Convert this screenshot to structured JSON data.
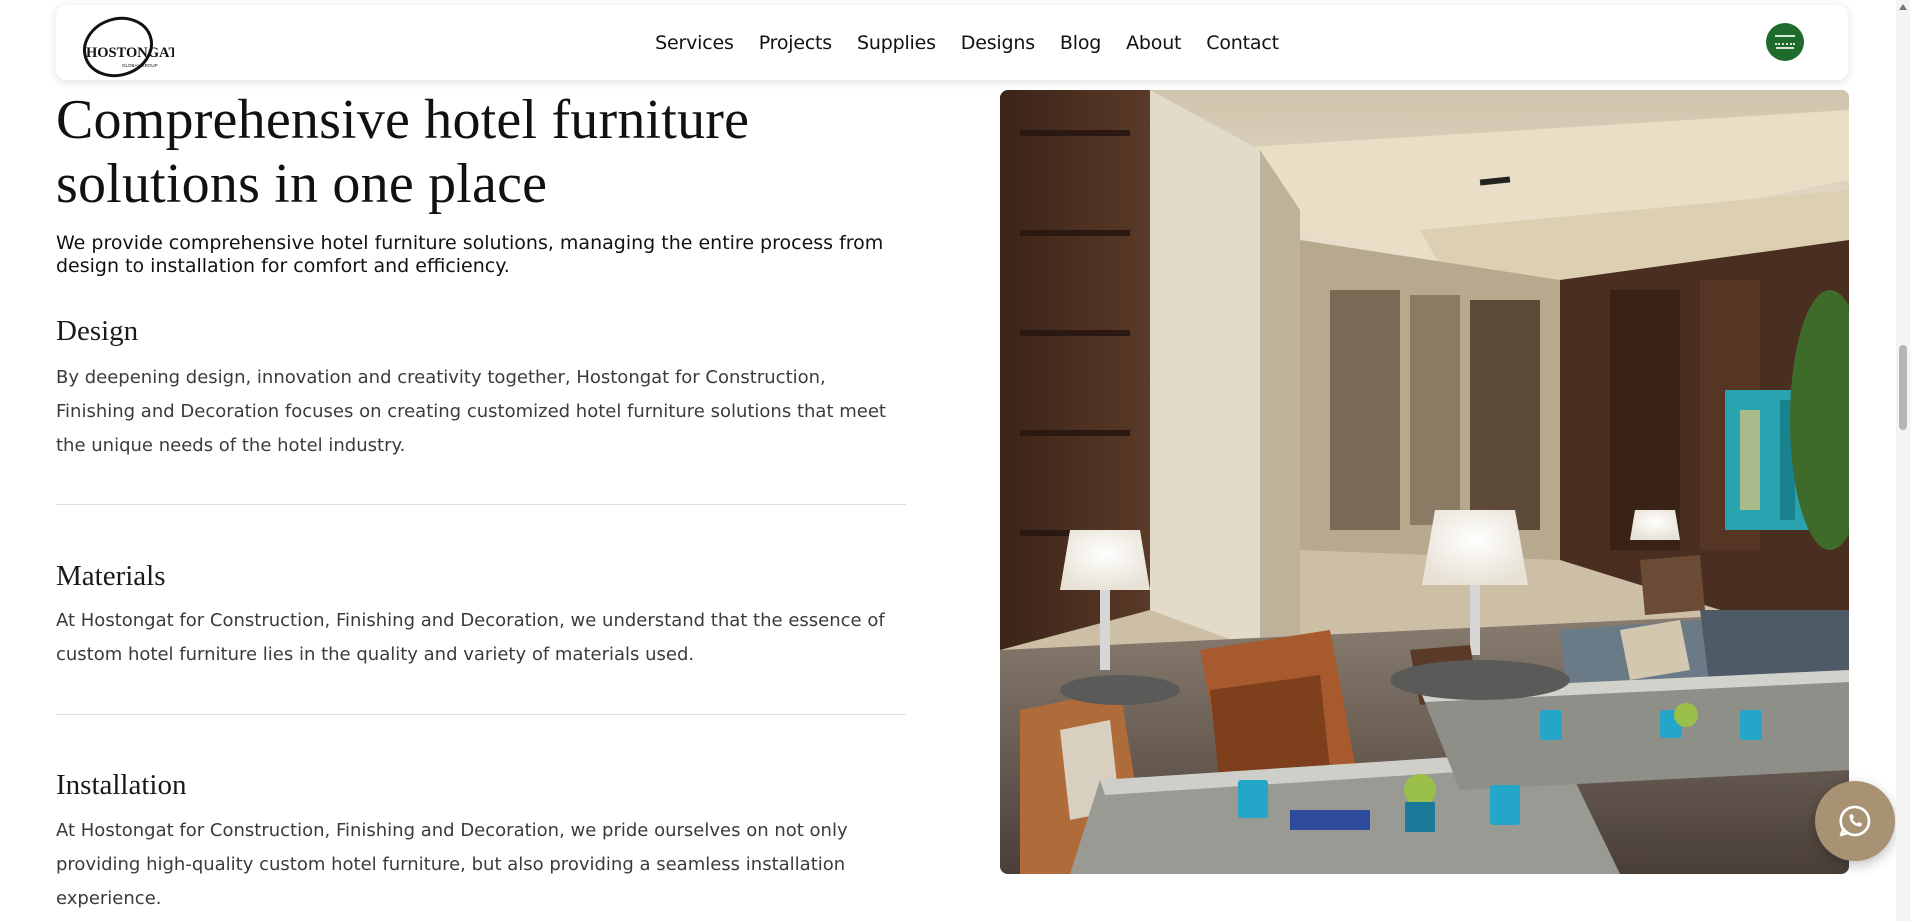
{
  "header": {
    "logo_text": "HOSTONGAT",
    "logo_subtext": "GLOBAL GROUP",
    "nav": [
      "Services",
      "Projects",
      "Supplies",
      "Designs",
      "Blog",
      "About",
      "Contact"
    ],
    "language_flag_icon": "saudi-flag-icon",
    "colors": {
      "flag": "#1f6b2c"
    }
  },
  "hero": {
    "title": "Comprehensive hotel furniture solutions in one place",
    "lead": "We provide comprehensive hotel furniture solutions, managing the entire process from design to installation for comfort and efficiency."
  },
  "sections": [
    {
      "title": "Design",
      "body": "By deepening design, innovation and creativity together, Hostongat for Construction, Finishing and Decoration focuses on creating customized hotel furniture solutions that meet the unique needs of the hotel industry."
    },
    {
      "title": "Materials",
      "body": "At Hostongat for Construction, Finishing and Decoration, we understand that the essence of custom hotel furniture lies in the quality and variety of materials used."
    },
    {
      "title": "Installation",
      "body": "At Hostongat for Construction, Finishing and Decoration, we pride ourselves on not only providing high-quality custom hotel furniture, but also providing a seamless installation experience."
    }
  ],
  "floating": {
    "whatsapp_icon": "whatsapp-icon",
    "color": "#a89274"
  }
}
